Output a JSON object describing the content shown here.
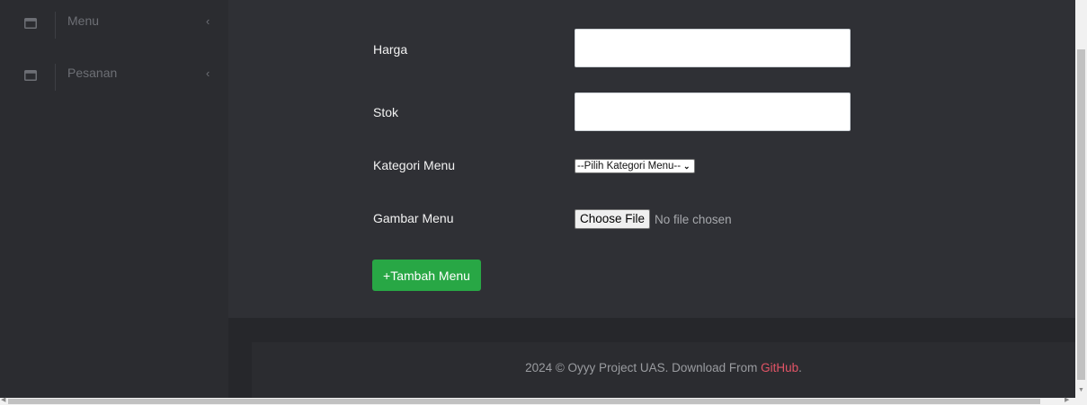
{
  "sidebar": {
    "items": [
      {
        "label": "Menu",
        "icon": "window-icon",
        "chevron": "‹"
      },
      {
        "label": "Pesanan",
        "icon": "window-icon",
        "chevron": "‹"
      }
    ]
  },
  "form": {
    "harga_label": "Harga",
    "harga_value": "",
    "stok_label": "Stok",
    "stok_value": "",
    "kategori_label": "Kategori Menu",
    "kategori_selected": "--Pilih Kategori Menu--",
    "gambar_label": "Gambar Menu",
    "file_button": "Choose File",
    "file_status": "No file chosen",
    "submit_label": "+Tambah Menu"
  },
  "footer": {
    "text": "2024 © Oyyy Project UAS. Download From ",
    "link": "GitHub",
    "suffix": "."
  },
  "colors": {
    "sidebar_bg": "#2b2c30",
    "main_bg": "#2f3035",
    "accent_green": "#28a745",
    "link_red": "#e25466"
  }
}
